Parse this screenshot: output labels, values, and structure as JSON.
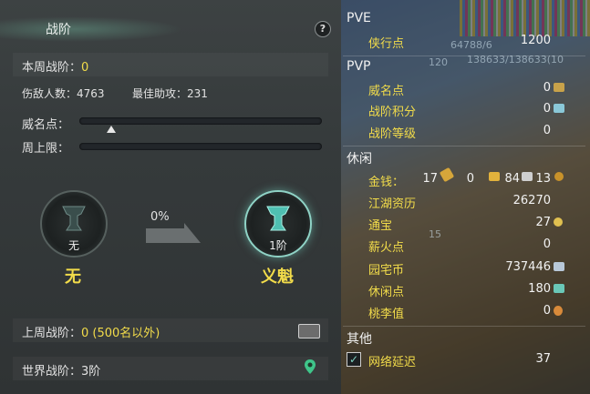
{
  "left": {
    "title": "战阶",
    "help_glyph": "?",
    "weekly_rank_label": "本周战阶：",
    "weekly_rank_value": "0",
    "enemies_label": "伤敌人数：",
    "enemies_value": "4763",
    "best_assist_label": "最佳助攻：",
    "best_assist_value": "231",
    "prestige_label": "威名点：",
    "prestige_progress": 0.13,
    "weekly_cap_label": "周上限：",
    "weekly_cap_progress": 0.0,
    "current_rank_medal": "无",
    "current_rank_name": "无",
    "progress_percent": "0%",
    "next_rank_medal": "1阶",
    "next_rank_name": "义魁",
    "last_week_label": "上周战阶：",
    "last_week_value": "0 (500名以外)",
    "world_rank_label": "世界战阶：",
    "world_rank_value": "3阶"
  },
  "right": {
    "pve_title": "PVE",
    "pve_items": [
      {
        "label": "侠行点",
        "value": "1200"
      }
    ],
    "pvp_title": "PVP",
    "pvp_items": [
      {
        "label": "威名点",
        "value": "0"
      },
      {
        "label": "战阶积分",
        "value": "0"
      },
      {
        "label": "战阶等级",
        "value": "0"
      }
    ],
    "leisure_title": "休闲",
    "money_label": "金钱：",
    "money_gold": "17",
    "money_silver": "0",
    "money_c1": "84",
    "money_c2": "13",
    "leisure_items": [
      {
        "label": "江湖资历",
        "value": "26270"
      },
      {
        "label": "通宝",
        "value": "27"
      },
      {
        "label": "薪火点",
        "value": "0"
      },
      {
        "label": "园宅币",
        "value": "737446"
      },
      {
        "label": "休闲点",
        "value": "180"
      },
      {
        "label": "桃李值",
        "value": "0"
      }
    ],
    "other_title": "其他",
    "latency_label": "网络延迟",
    "latency_value": "37",
    "bg_overlay_1": "64788/6",
    "bg_overlay_2": "138633/138633(10",
    "bg_overlay_3": "120",
    "bg_overlay_4": "15"
  },
  "colors": {
    "accent_yellow": "#f2dc4a",
    "teal": "#8fd3c6"
  }
}
